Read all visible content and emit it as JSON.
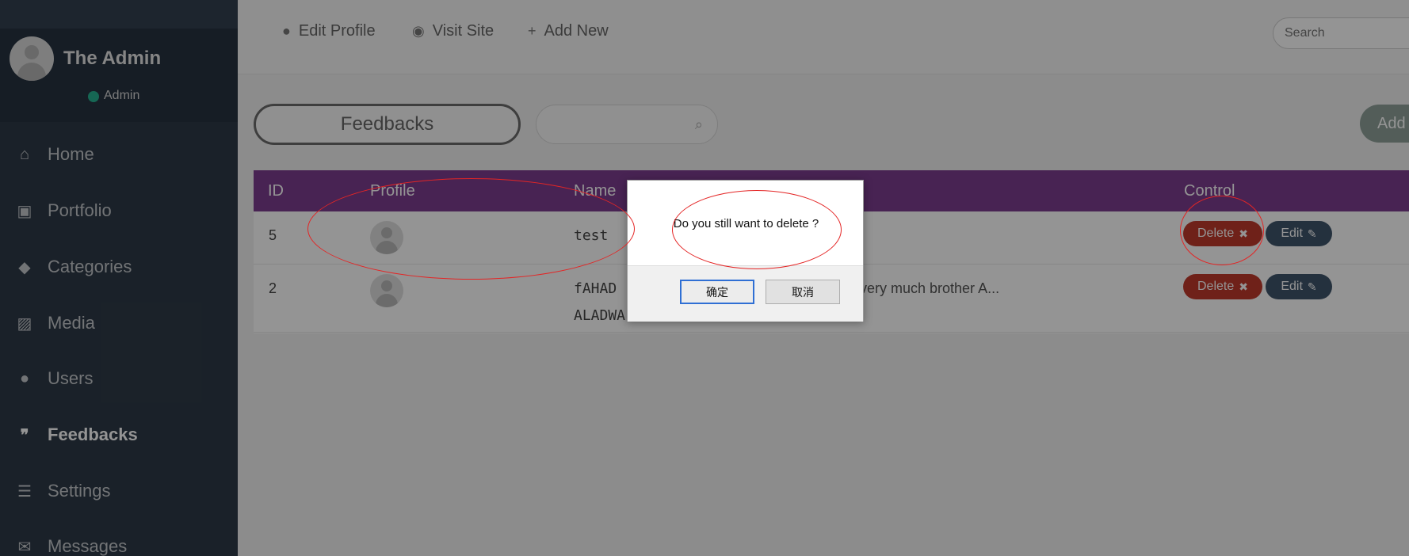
{
  "sidebar": {
    "user": {
      "name": "The Admin",
      "role": "Admin"
    },
    "items": [
      {
        "label": "Home",
        "icon": "home-icon",
        "glyph": "⌂"
      },
      {
        "label": "Portfolio",
        "icon": "briefcase-icon",
        "glyph": "▣"
      },
      {
        "label": "Categories",
        "icon": "tag-icon",
        "glyph": "◆"
      },
      {
        "label": "Media",
        "icon": "image-icon",
        "glyph": "▨"
      },
      {
        "label": "Users",
        "icon": "user-icon",
        "glyph": "●"
      },
      {
        "label": "Feedbacks",
        "icon": "quote-icon",
        "glyph": "❞"
      },
      {
        "label": "Settings",
        "icon": "sliders-icon",
        "glyph": "☰"
      },
      {
        "label": "Messages",
        "icon": "envelope-icon",
        "glyph": "✉"
      }
    ]
  },
  "topbar": {
    "links": [
      {
        "label": "Edit Profile",
        "icon": "user-icon",
        "glyph": "●"
      },
      {
        "label": "Visit Site",
        "icon": "globe-icon",
        "glyph": "◉"
      },
      {
        "label": "Add New",
        "icon": "plus-icon",
        "glyph": "+"
      }
    ],
    "search_placeholder": "Search"
  },
  "content": {
    "title": "Feedbacks",
    "add_label": "Add",
    "columns": {
      "id": "ID",
      "profile": "Profile",
      "name": "Name",
      "control": "Control"
    },
    "rows": [
      {
        "id": "5",
        "name": "test",
        "message": ""
      },
      {
        "id": "2",
        "name": "fAHAD\nALADWA",
        "message": "very much brother A..."
      }
    ],
    "delete_label": "Delete",
    "edit_label": "Edit"
  },
  "dialog": {
    "message": "Do you still want to delete ?",
    "ok_label": "确定",
    "cancel_label": "取消"
  },
  "colors": {
    "sidebar": "#2e3a47",
    "table_header": "#7d3d8f",
    "delete": "#c0392b",
    "edit": "#3f556b",
    "status_online": "#26b291",
    "annotation": "#e42525"
  }
}
